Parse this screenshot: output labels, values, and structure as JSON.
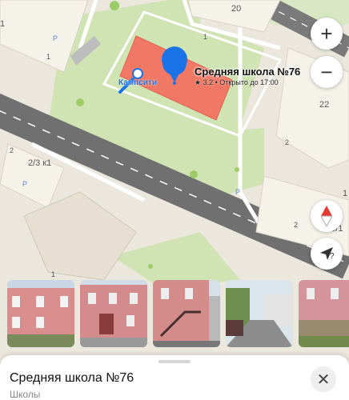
{
  "map": {
    "house_numbers": [
      "20",
      "1",
      "1",
      "1",
      "22",
      "2",
      "2/3 к1",
      "2",
      "2",
      "1",
      "159/1",
      "1"
    ],
    "parking_symbol": "P",
    "entrance_label": "Кампсити"
  },
  "poi": {
    "name": "Средняя школа №76",
    "rating": "3.2",
    "status": "Открыто до 17:00",
    "separator": "•",
    "star": "★"
  },
  "controls": {
    "zoom_in": "+",
    "zoom_out": "−",
    "location_label": "?"
  },
  "photos_count": 6,
  "place_card": {
    "title": "Средняя школа №76",
    "category": "Школы",
    "close": "✕"
  },
  "colors": {
    "land": "#ece7dc",
    "green": "#cfe3b3",
    "road": "#7c7c7c",
    "building": "#f5f2ea",
    "highlight": "#f07864",
    "marker": "#1a73e8"
  }
}
